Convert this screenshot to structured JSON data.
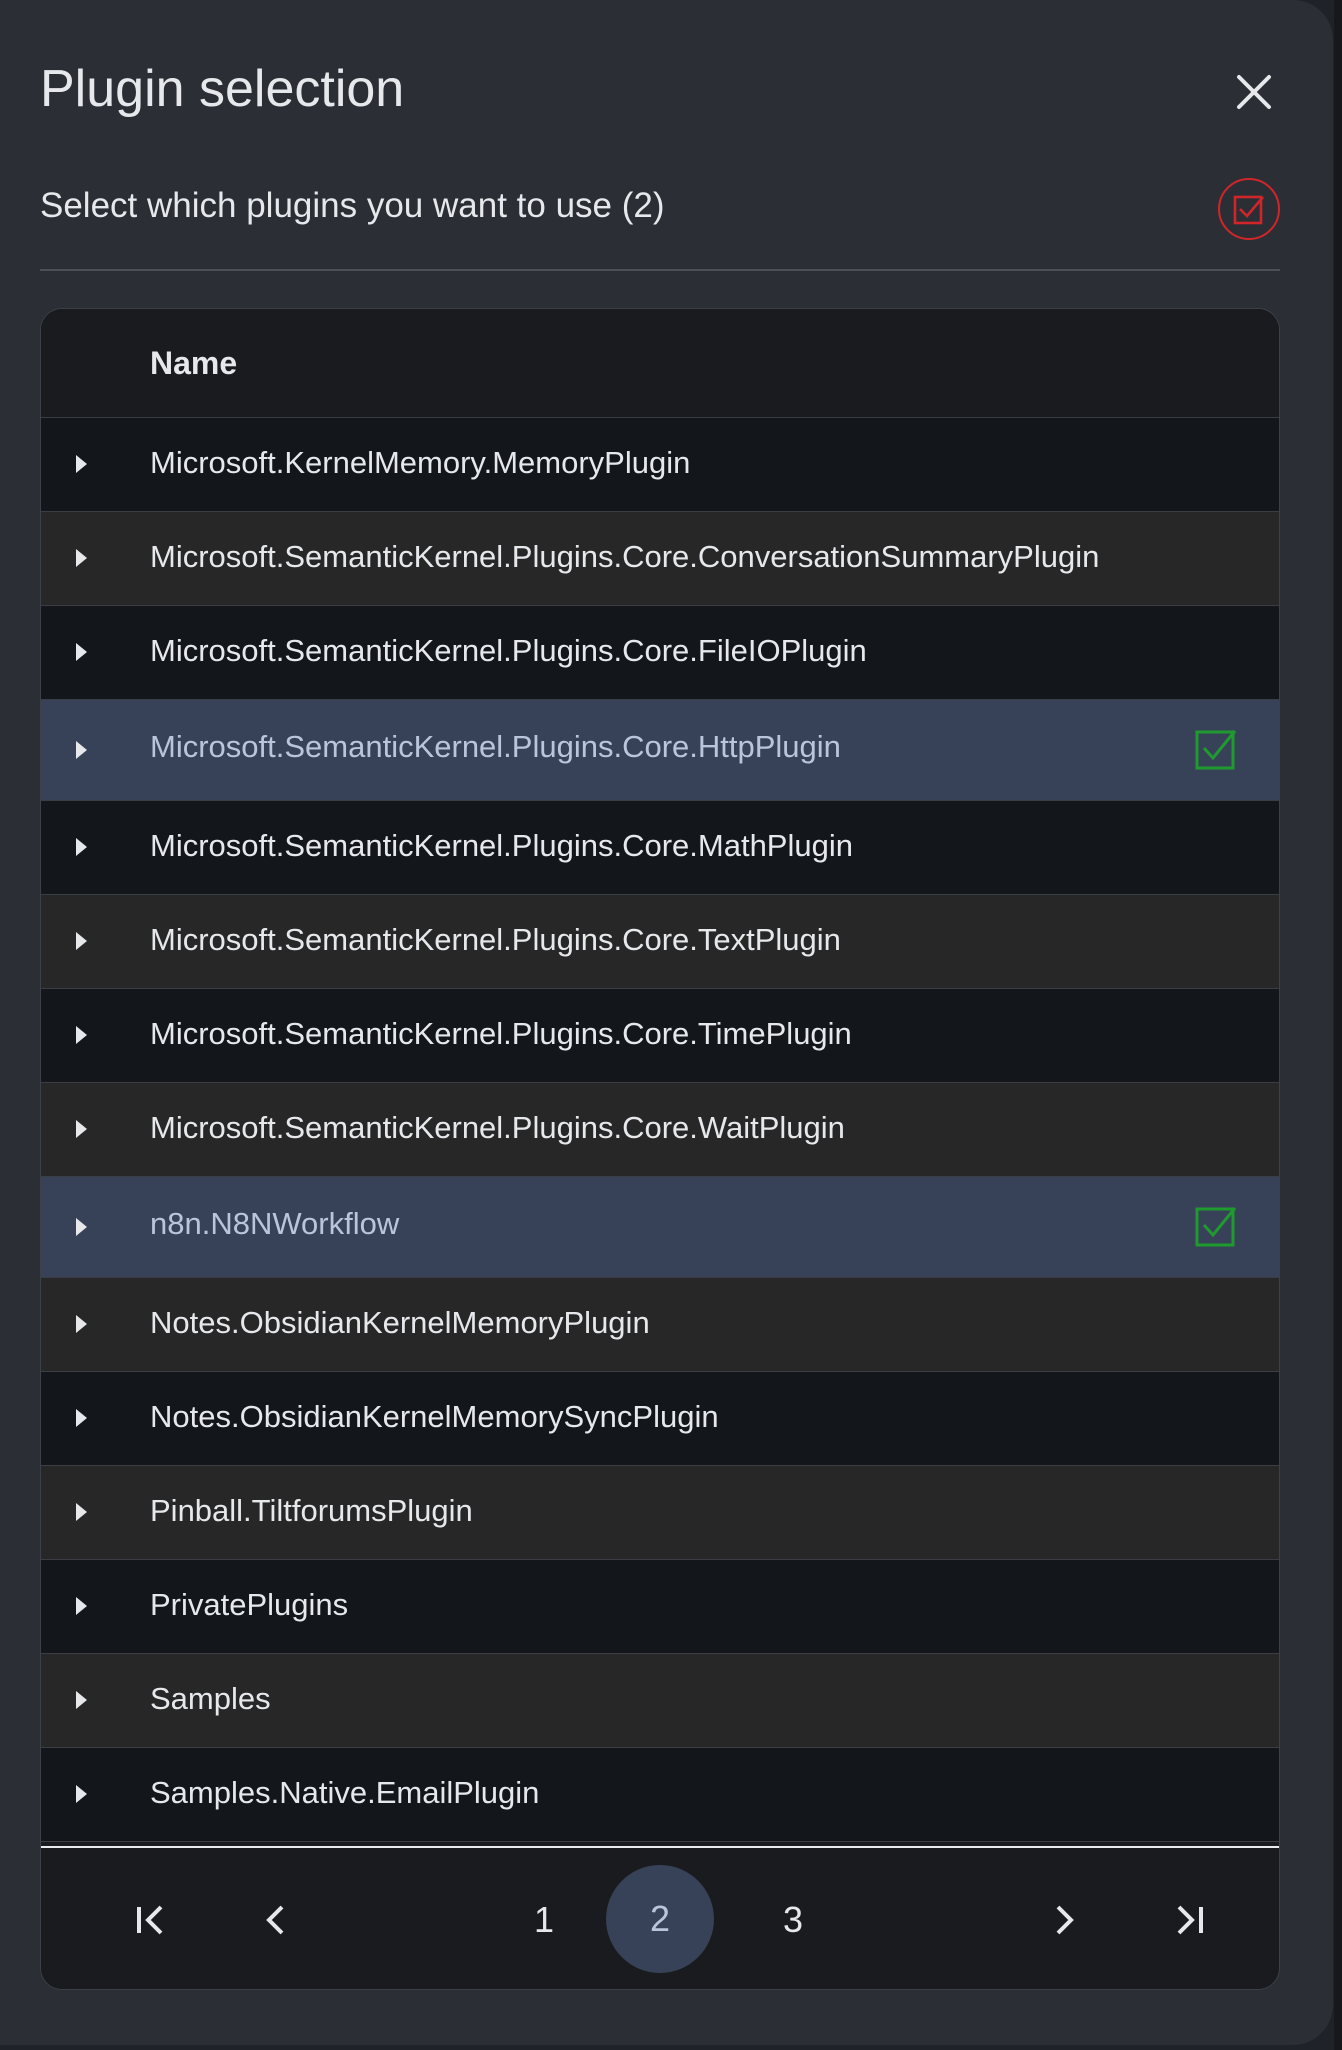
{
  "dialog": {
    "title": "Plugin selection",
    "subtitle": "Select which plugins you want to use (2)"
  },
  "icons": {
    "close": "close-icon",
    "select_all": "checkbox-checked-icon",
    "expand": "caret-right-icon",
    "row_check": "checkbox-checked-icon",
    "first_page": "first-page-icon",
    "prev_page": "chevron-left-icon",
    "next_page": "chevron-right-icon",
    "last_page": "last-page-icon"
  },
  "colors": {
    "accent_red": "#d0262a",
    "check_green": "#1f9a2e",
    "selected_row": "#374258"
  },
  "table": {
    "header": {
      "name": "Name"
    },
    "rows": [
      {
        "name": "Microsoft.KernelMemory.MemoryPlugin",
        "selected": false
      },
      {
        "name": "Microsoft.SemanticKernel.Plugins.Core.ConversationSummaryPlugin",
        "selected": false
      },
      {
        "name": "Microsoft.SemanticKernel.Plugins.Core.FileIOPlugin",
        "selected": false
      },
      {
        "name": "Microsoft.SemanticKernel.Plugins.Core.HttpPlugin",
        "selected": true
      },
      {
        "name": "Microsoft.SemanticKernel.Plugins.Core.MathPlugin",
        "selected": false
      },
      {
        "name": "Microsoft.SemanticKernel.Plugins.Core.TextPlugin",
        "selected": false
      },
      {
        "name": "Microsoft.SemanticKernel.Plugins.Core.TimePlugin",
        "selected": false
      },
      {
        "name": "Microsoft.SemanticKernel.Plugins.Core.WaitPlugin",
        "selected": false
      },
      {
        "name": "n8n.N8NWorkflow",
        "selected": true
      },
      {
        "name": "Notes.ObsidianKernelMemoryPlugin",
        "selected": false
      },
      {
        "name": "Notes.ObsidianKernelMemorySyncPlugin",
        "selected": false
      },
      {
        "name": "Pinball.TiltforumsPlugin",
        "selected": false
      },
      {
        "name": "PrivatePlugins",
        "selected": false
      },
      {
        "name": "Samples",
        "selected": false
      },
      {
        "name": "Samples.Native.EmailPlugin",
        "selected": false
      }
    ]
  },
  "pagination": {
    "pages": [
      "1",
      "2",
      "3"
    ],
    "current_page": "2"
  }
}
